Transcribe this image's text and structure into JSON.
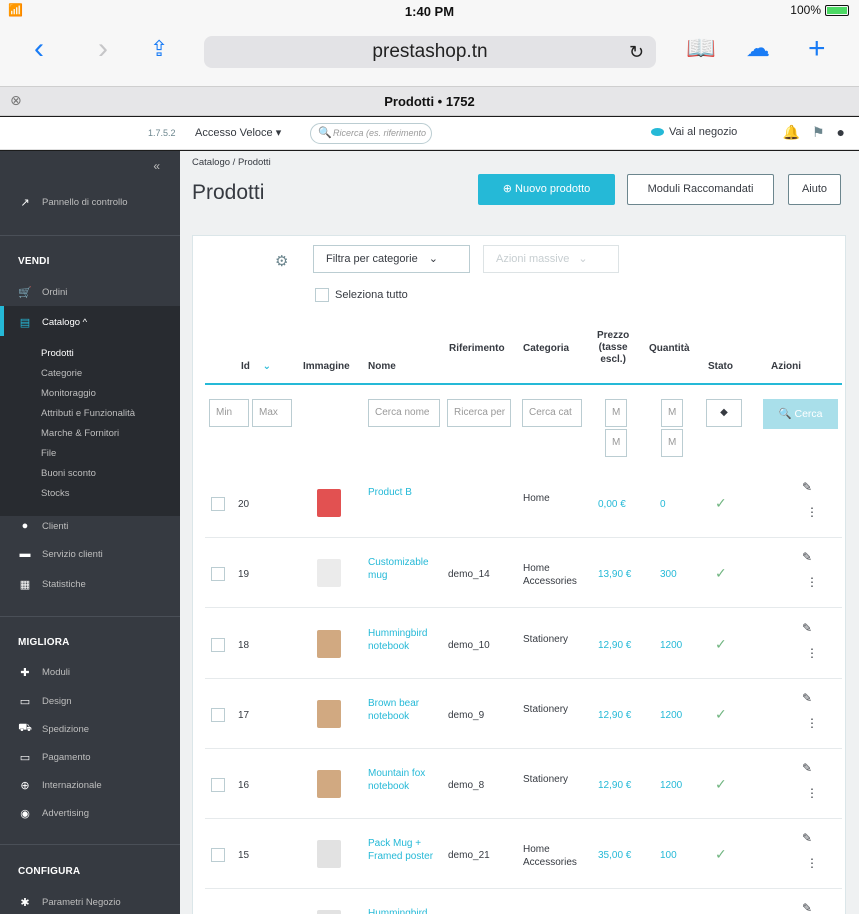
{
  "status_bar": {
    "time": "1:40 PM",
    "battery": "100%"
  },
  "browser": {
    "url": "prestashop.tn",
    "tab_title": "Prodotti • 1752"
  },
  "header": {
    "version": "1.7.5.2",
    "quick_access": "Accesso Veloce ▾",
    "search_placeholder": "Ricerca (es. riferimento",
    "view_shop": "Vai al negozio"
  },
  "sidebar": {
    "dashboard": "Pannello di controllo",
    "section_sell": "VENDI",
    "orders": "Ordini",
    "catalog": "Catalogo ^",
    "catalog_sub": [
      "Prodotti",
      "Categorie",
      "Monitoraggio",
      "Attributi e Funzionalità",
      "Marche & Fornitori",
      "File",
      "Buoni sconto",
      "Stocks"
    ],
    "customers": "Clienti",
    "customer_service": "Servizio clienti",
    "stats": "Statistiche",
    "section_improve": "MIGLIORA",
    "modules": "Moduli",
    "design": "Design",
    "shipping": "Spedizione",
    "payment": "Pagamento",
    "international": "Internazionale",
    "advertising": "Advertising",
    "section_configure": "CONFIGURA",
    "shop_params": "Parametri Negozio"
  },
  "page": {
    "breadcrumb": "Catalogo / Prodotti",
    "title": "Prodotti",
    "btn_new": "⊕ Nuovo prodotto",
    "btn_recommended": "Moduli Raccomandati",
    "btn_help": "Aiuto"
  },
  "toolbar": {
    "filter_category": "Filtra per categorie",
    "bulk_actions": "Azioni massive",
    "select_all": "Seleziona tutto"
  },
  "table": {
    "headers": {
      "id": "Id",
      "image": "Immagine",
      "name": "Nome",
      "reference": "Riferimento",
      "category": "Categoria",
      "price": "Prezzo\n(tasse\nescl.)",
      "quantity": "Quantità",
      "status": "Stato",
      "actions": "Azioni"
    },
    "filters": {
      "id_min": "Min",
      "id_max": "Max",
      "name": "Cerca nome",
      "reference": "Ricerca per",
      "category": "Cerca cat",
      "price_min": "M",
      "price_max": "M",
      "qty_min": "M",
      "qty_max": "M",
      "search_btn": "🔍 Cerca"
    },
    "rows": [
      {
        "id": "20",
        "name": "Product B",
        "reference": "",
        "category": "Home",
        "price": "0,00 €",
        "quantity": "0",
        "thumb_color": "#d33"
      },
      {
        "id": "19",
        "name": "Customizable mug",
        "reference": "demo_14",
        "category": "Home Accessories",
        "price": "13,90 €",
        "quantity": "300",
        "thumb_color": "#e8e8e8"
      },
      {
        "id": "18",
        "name": "Hummingbird notebook",
        "reference": "demo_10",
        "category": "Stationery",
        "price": "12,90 €",
        "quantity": "1200",
        "thumb_color": "#c99a6b"
      },
      {
        "id": "17",
        "name": "Brown bear notebook",
        "reference": "demo_9",
        "category": "Stationery",
        "price": "12,90 €",
        "quantity": "1200",
        "thumb_color": "#c99a6b"
      },
      {
        "id": "16",
        "name": "Mountain fox notebook",
        "reference": "demo_8",
        "category": "Stationery",
        "price": "12,90 €",
        "quantity": "1200",
        "thumb_color": "#c99a6b"
      },
      {
        "id": "15",
        "name": "Pack Mug + Framed poster",
        "reference": "demo_21",
        "category": "Home Accessories",
        "price": "35,00 €",
        "quantity": "100",
        "thumb_color": "#ddd"
      },
      {
        "id": "",
        "name": "Hummingbird",
        "reference": "",
        "category": "",
        "price": "",
        "quantity": "",
        "thumb_color": "#ddd"
      }
    ]
  },
  "colors": {
    "accent": "#25b9d7",
    "sidebar_bg": "#363a41",
    "status_ok": "#70b580"
  }
}
